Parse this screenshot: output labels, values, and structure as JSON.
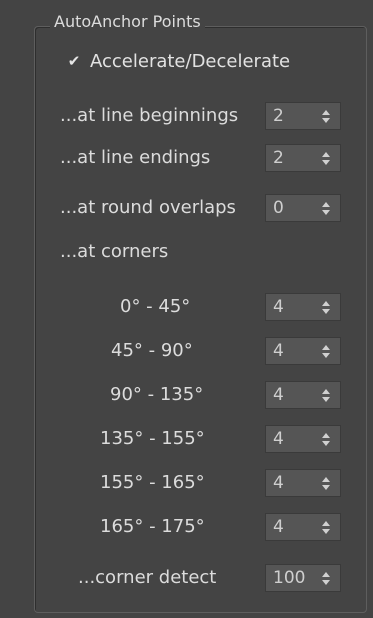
{
  "group_title": "AutoAnchor Points",
  "checkbox": {
    "label": "Accelerate/Decelerate",
    "checked": true,
    "icon": "checkmark-icon"
  },
  "rows": {
    "line_beginnings": {
      "label": "...at line beginnings",
      "value": "2"
    },
    "line_endings": {
      "label": "...at line endings",
      "value": "2"
    },
    "round_overlaps": {
      "label": "...at round overlaps",
      "value": "0"
    },
    "corners_heading": {
      "label": "...at corners"
    },
    "c0_45": {
      "label": "0° -  45°",
      "value": "4"
    },
    "c45_90": {
      "label": "45° -  90°",
      "value": "4"
    },
    "c90_135": {
      "label": "90° - 135°",
      "value": "4"
    },
    "c135_155": {
      "label": "135° - 155°",
      "value": "4"
    },
    "c155_165": {
      "label": "155° - 165°",
      "value": "4"
    },
    "c165_175": {
      "label": "165° - 175°",
      "value": "4"
    },
    "corner_detect": {
      "label": "...corner detect",
      "value": "100"
    }
  }
}
